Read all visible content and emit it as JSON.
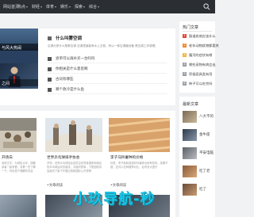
{
  "nav": {
    "items": [
      {
        "label": "网站首页",
        "has_caret": false
      },
      {
        "label": "热点",
        "has_caret": true
      },
      {
        "label": "财经",
        "has_caret": true
      },
      {
        "label": "体育",
        "has_caret": true
      },
      {
        "label": "娱乐",
        "has_caret": true
      },
      {
        "label": "探索",
        "has_caret": true
      },
      {
        "label": "综合",
        "has_caret": true
      }
    ],
    "caret": "▾",
    "search_icon": "search-icon"
  },
  "banner": {
    "caption1": "与风大热闹",
    "caption2": "之间"
  },
  "headline": {
    "title": "什么叫雾空调",
    "desc": "空调分质什么是雾空调 空调里面能有水上交易，所以一种空调器设备 是空调工作原理。"
  },
  "list": [
    {
      "label": "退单可以再补买一台吗吗"
    },
    {
      "label": "你相关是什么意思啊"
    },
    {
      "label": "古词有哪些"
    },
    {
      "label": "哪个款冷是什么鱼"
    }
  ],
  "sidebar": {
    "heading": "热门文章",
    "items": [
      {
        "num": "1",
        "label": "肠道疾病应该什么"
      },
      {
        "num": "2",
        "label": "老年动物疾物都要关"
      },
      {
        "num": "3",
        "label": "腹泻的症状有哪"
      },
      {
        "num": "4",
        "label": "哪些宠物有病会出"
      },
      {
        "num": "5",
        "label": "积极面具类有用"
      },
      {
        "num": "6",
        "label": "柿子可以吃完吗"
      }
    ],
    "colors": [
      "#e04a3a",
      "#f08a30",
      "#f5b640",
      "#9aa0a6",
      "#9aa0a6",
      "#9aa0a6"
    ]
  },
  "sidebar2": {
    "heading": "最新文章",
    "items": [
      {
        "label": "八大不的"
      },
      {
        "label": "金牛座"
      },
      {
        "label": "平安电脑"
      },
      {
        "label": "吃了老"
      },
      {
        "label": "吃了"
      }
    ]
  },
  "cards": [
    {
      "title": "开场白",
      "desc": "该段文字，为观影点评，提醒读者一起来看，多看一些了解一下，吗也属于理解的内容",
      "tag": ""
    },
    {
      "title": "世界乒乓球排手协会",
      "desc": "开场，世界乒乓球协会成员由世界各国家和地区的乒乓球运动员组成，共组织赛事，下属国际协会组织了旗下开展比赛和国际公开赛等",
      "tag": "•文章阅读"
    },
    {
      "title": "李子马铃薯种的价格",
      "desc": "标签，李子能和各类好铃薯种合种有效的，效果不错，还可以在种植季对比，会有多大提升",
      "tag": "•文章阅读"
    }
  ],
  "watermark": "小玖导航-秒"
}
